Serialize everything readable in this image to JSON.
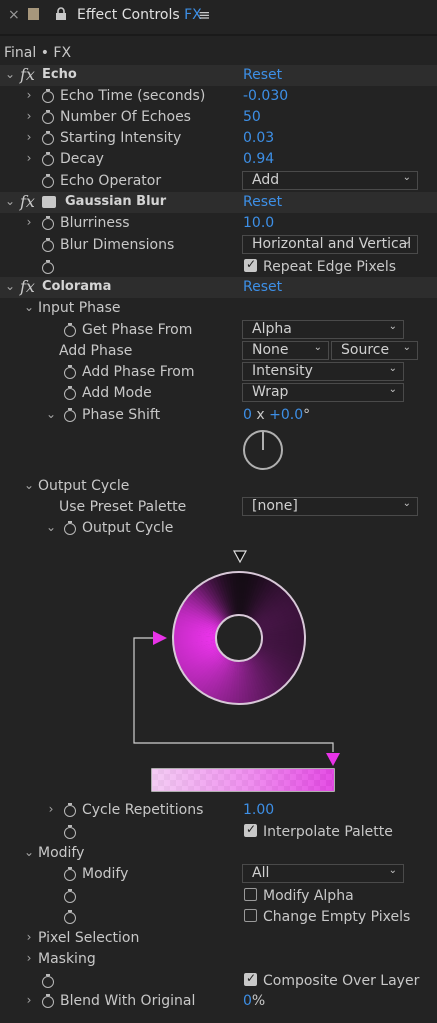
{
  "panel": {
    "close": "×",
    "title": "Effect Controls",
    "title_accent": "FX",
    "menu": "≡",
    "layer": "Final • FX"
  },
  "echo": {
    "name": "Echo",
    "reset": "Reset",
    "echo_time": {
      "label": "Echo Time (seconds)",
      "value": "-0.030"
    },
    "num_echoes": {
      "label": "Number Of Echoes",
      "value": "50"
    },
    "start_int": {
      "label": "Starting Intensity",
      "value": "0.03"
    },
    "decay": {
      "label": "Decay",
      "value": "0.94"
    },
    "operator": {
      "label": "Echo Operator",
      "value": "Add"
    }
  },
  "blur": {
    "name": "Gaussian Blur",
    "reset": "Reset",
    "blurriness": {
      "label": "Blurriness",
      "value": "10.0"
    },
    "dims": {
      "label": "Blur Dimensions",
      "value": "Horizontal and Vertical"
    },
    "repeat": {
      "label": "Repeat Edge Pixels",
      "checked": true
    }
  },
  "colorama": {
    "name": "Colorama",
    "reset": "Reset",
    "input_phase": {
      "label": "Input Phase",
      "get_phase": {
        "label": "Get Phase From",
        "value": "Alpha"
      },
      "add_phase": {
        "label": "Add Phase",
        "value": "None",
        "value2": "Source"
      },
      "add_phase_from": {
        "label": "Add Phase From",
        "value": "Intensity"
      },
      "add_mode": {
        "label": "Add Mode",
        "value": "Wrap"
      },
      "phase_shift": {
        "label": "Phase Shift",
        "rev": "0",
        "x": "x",
        "deg": "+0.0",
        "unit": "°"
      }
    },
    "output_cycle": {
      "label": "Output Cycle",
      "preset": {
        "label": "Use Preset Palette",
        "value": "[none]"
      },
      "cycle_label": "Output Cycle",
      "colors": {
        "start": "#e833e8",
        "dark": "#0a0a0a"
      },
      "cycle_reps": {
        "label": "Cycle Repetitions",
        "value": "1.00"
      },
      "interp": {
        "label": "Interpolate Palette",
        "checked": true
      }
    },
    "modify": {
      "label": "Modify",
      "modify_sel": {
        "label": "Modify",
        "value": "All"
      },
      "modify_alpha": {
        "label": "Modify Alpha",
        "checked": false
      },
      "change_empty": {
        "label": "Change Empty Pixels",
        "checked": false
      }
    },
    "pixel_sel": {
      "label": "Pixel Selection"
    },
    "masking": {
      "label": "Masking"
    },
    "composite": {
      "label": "Composite Over Layer",
      "checked": true
    },
    "blend": {
      "label": "Blend With Original",
      "value": "0",
      "unit": "%"
    }
  }
}
